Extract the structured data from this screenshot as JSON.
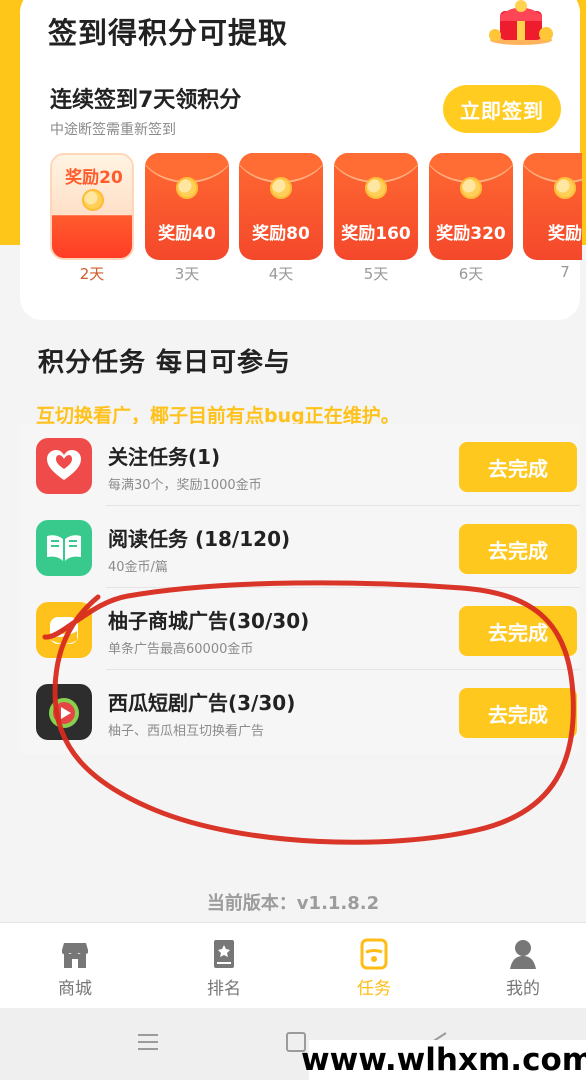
{
  "checkin": {
    "title": "签到得积分可提取",
    "streak_title": "连续签到7天领积分",
    "streak_subtitle": "中途断签需重新签到",
    "button": "立即签到",
    "rewards": [
      {
        "label": "奖励20",
        "day": "2天",
        "active": true
      },
      {
        "label": "奖励40",
        "day": "3天"
      },
      {
        "label": "奖励80",
        "day": "4天"
      },
      {
        "label": "奖励160",
        "day": "5天"
      },
      {
        "label": "奖励320",
        "day": "6天"
      },
      {
        "label": "奖励",
        "day": "7"
      }
    ]
  },
  "tasks_section": {
    "heading": "积分任务  每日可参与",
    "notice": "互切换看广，椰子目前有点bug正在维护。"
  },
  "tasks": [
    {
      "title": "关注任务(1)",
      "subtitle": "每满30个，奖励1000金币",
      "button": "去完成",
      "icon": "heart-icon",
      "color": "#f04b4b"
    },
    {
      "title": "阅读任务 (18/120)",
      "subtitle": "40金币/篇",
      "button": "去完成",
      "icon": "book-icon",
      "color": "#38c98d"
    },
    {
      "title": "柚子商城广告(30/30)",
      "subtitle": "单条广告最高60000金币",
      "button": "去完成",
      "icon": "pomelo-icon",
      "color": "#ffc21d"
    },
    {
      "title": "西瓜短剧广告(3/30)",
      "subtitle": "柚子、西瓜相互切换看广告",
      "button": "去完成",
      "icon": "watermelon-play-icon",
      "color": "#2d2d2d"
    }
  ],
  "version": "当前版本：v1.1.8.2",
  "bottom_nav": [
    {
      "label": "商城",
      "icon": "store-icon"
    },
    {
      "label": "排名",
      "icon": "ranking-icon"
    },
    {
      "label": "任务",
      "icon": "task-icon",
      "active": true
    },
    {
      "label": "我的",
      "icon": "profile-icon"
    }
  ],
  "watermark": "www.wlhxm.com",
  "colors": {
    "accent": "#ffc61a",
    "reward_red": "#f4482b",
    "active_nav": "#ffbb16",
    "annotation_red": "#d72a1e"
  }
}
